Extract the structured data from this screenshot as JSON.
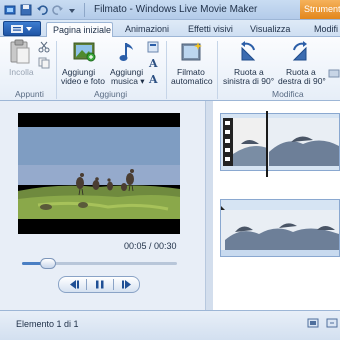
{
  "window": {
    "title": "Filmato - Windows Live Movie Maker",
    "tool_tab": "Strumenti video"
  },
  "tabs": [
    {
      "label": "Pagina iniziale",
      "active": true
    },
    {
      "label": "Animazioni",
      "active": false
    },
    {
      "label": "Effetti visivi",
      "active": false
    },
    {
      "label": "Visualizza",
      "active": false
    },
    {
      "label": "Modifi",
      "active": false
    }
  ],
  "ribbon": {
    "groups": {
      "appunti": "Appunti",
      "aggiungi": "Aggiungi",
      "modifica": "Modifica"
    },
    "buttons": {
      "paste": "Incolla",
      "add_video_line1": "Aggiungi",
      "add_video_line2": "video e foto",
      "add_music_line1": "Aggiungi",
      "add_music_line2": "musica ▾",
      "automovie_line1": "Filmato",
      "automovie_line2": "automatico",
      "rotate_left_line1": "Ruota a",
      "rotate_left_line2": "sinistra di 90°",
      "rotate_right_line1": "Ruota a",
      "rotate_right_line2": "destra di 90°"
    }
  },
  "preview": {
    "time": "00:05 / 00:30",
    "progress_fraction": 0.17
  },
  "status": {
    "item_text": "Elemento 1 di 1"
  },
  "colors": {
    "accent": "#1f55a6",
    "tool_tab": "#e2861b"
  }
}
